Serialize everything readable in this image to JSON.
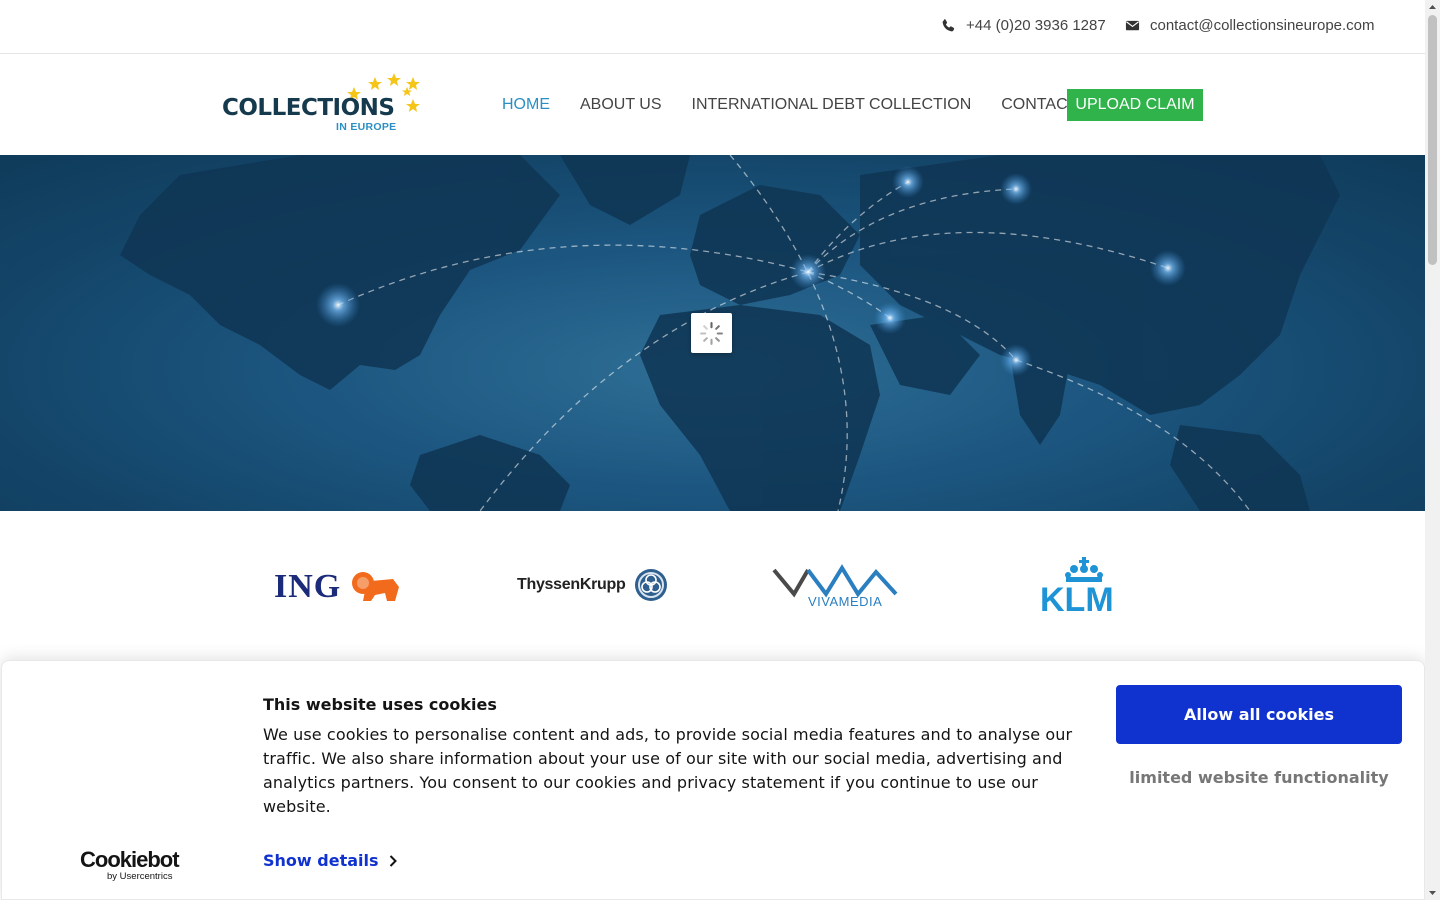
{
  "topbar": {
    "phone": "+44 (0)20 3936 1287",
    "email": "contact@collectionsineurope.com",
    "phone_icon": "phone-icon",
    "email_icon": "envelope-icon"
  },
  "header": {
    "logo_main": "COLLECTIONS",
    "logo_sub": "IN EUROPE",
    "nav": [
      {
        "label": "HOME",
        "active": true
      },
      {
        "label": "ABOUT US",
        "active": false
      },
      {
        "label": "INTERNATIONAL DEBT COLLECTION",
        "active": false
      },
      {
        "label": "CONTACT",
        "active": false
      }
    ],
    "upload_label": "UPLOAD CLAIM"
  },
  "clients": {
    "ing": "ING",
    "thyssen": "ThyssenKrupp",
    "viva": "VIVAMEDIA",
    "klm": "KLM"
  },
  "cookie": {
    "title": "This website uses cookies",
    "text": "We use cookies to personalise content and ads, to provide social media features and to analyse our traffic. We also share information about your use of our site with our social media, advertising and analytics partners. You consent to our cookies and privacy statement if you continue to use our website.",
    "show_details": "Show details",
    "allow_all": "Allow all cookies",
    "limited": "limited website functionality",
    "brand": "Cookiebot",
    "brand_sub": "by Usercentrics"
  },
  "colors": {
    "accent_blue": "#2b8fc4",
    "upload_green": "#2fb34a",
    "cookie_blue": "#1032cf",
    "logo_navy": "#163a4d"
  }
}
